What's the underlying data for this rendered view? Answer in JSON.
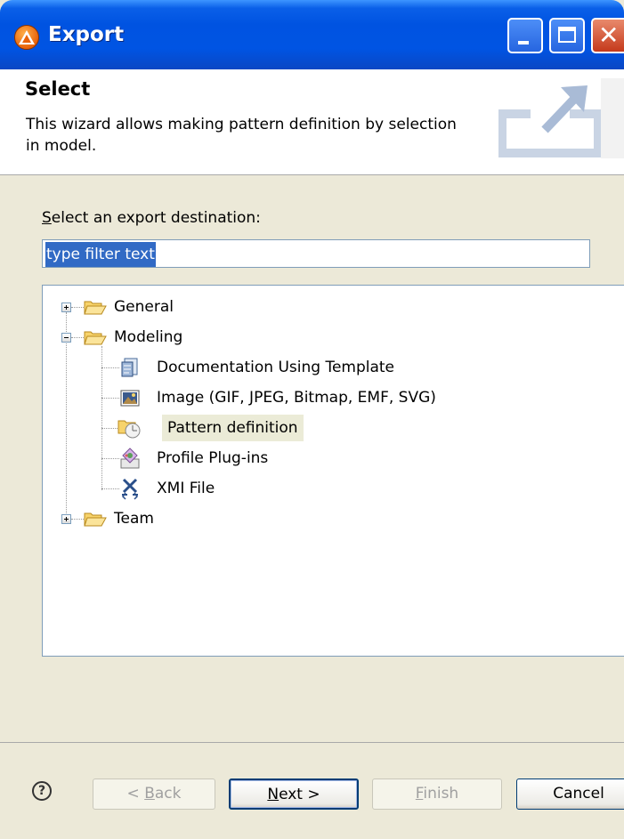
{
  "window": {
    "title": "Export"
  },
  "header": {
    "title": "Select",
    "description": "This wizard allows making pattern definition by selection in model."
  },
  "destination": {
    "label_prefix": "S",
    "label_rest": "elect an export destination:",
    "filter_value": "type filter text"
  },
  "tree": {
    "nodes": [
      {
        "label": "General",
        "level": 0,
        "expander": "plus",
        "icon": "folder-icon"
      },
      {
        "label": "Modeling",
        "level": 0,
        "expander": "minus",
        "icon": "folder-icon"
      },
      {
        "label": "Documentation Using Template",
        "level": 1,
        "icon": "document-template-icon"
      },
      {
        "label": "Image (GIF, JPEG, Bitmap, EMF, SVG)",
        "level": 1,
        "icon": "image-icon"
      },
      {
        "label": "Pattern definition",
        "level": 1,
        "icon": "pattern-icon",
        "selected": true
      },
      {
        "label": "Profile Plug-ins",
        "level": 1,
        "icon": "profile-plugin-icon"
      },
      {
        "label": "XMI File",
        "level": 1,
        "icon": "xmi-file-icon"
      },
      {
        "label": "Team",
        "level": 0,
        "expander": "plus",
        "icon": "folder-icon"
      }
    ]
  },
  "buttons": {
    "back_prefix": "< ",
    "back_mnemonic": "B",
    "back_rest": "ack",
    "next_mnemonic": "N",
    "next_rest": "ext >",
    "finish_mnemonic": "F",
    "finish_rest": "inish",
    "cancel": "Cancel"
  },
  "colors": {
    "titlebar": "#0054e3",
    "dialog_bg": "#ece9d8",
    "selection": "#316ac5"
  }
}
